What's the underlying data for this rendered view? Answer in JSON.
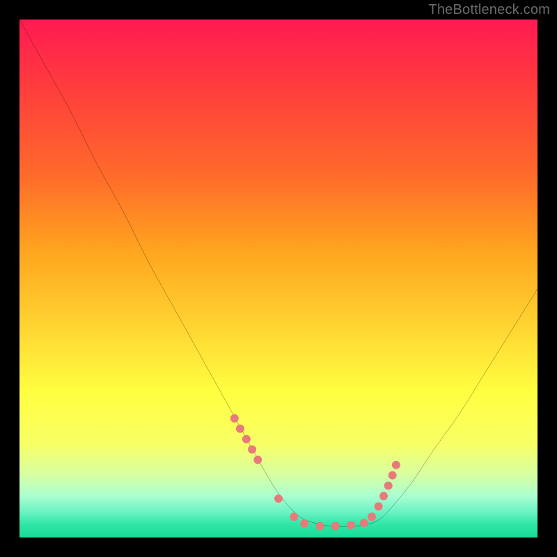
{
  "watermark": "TheBottleneck.com",
  "chart_data": {
    "type": "line",
    "title": "",
    "xlabel": "",
    "ylabel": "",
    "xlim": [
      0,
      100
    ],
    "ylim": [
      0,
      100
    ],
    "grid": false,
    "legend": false,
    "notes": "Axes are unlabeled; x and y are expressed as percent of plot width/height with origin at top-left (y increases downward). The black curve descends from upper-left into a flat trough near the bottom then rises toward the right. Salmon dots mark sample points near the trough. Background is a vertical red-to-green gradient.",
    "series": [
      {
        "name": "curve",
        "type": "line",
        "color": "#000000",
        "x": [
          0,
          5,
          10,
          15,
          20,
          25,
          30,
          35,
          40,
          45,
          49,
          52,
          55,
          60,
          65,
          69,
          72,
          76,
          80,
          85,
          90,
          95,
          100
        ],
        "y": [
          0,
          9,
          18,
          28,
          37,
          47,
          56,
          65,
          74,
          83,
          90,
          94,
          96.5,
          97.8,
          97.8,
          96.8,
          94,
          89,
          83,
          76,
          68,
          60,
          52
        ]
      },
      {
        "name": "trough-dots",
        "type": "scatter",
        "color": "#e77a7a",
        "x": [
          41.5,
          42.6,
          43.8,
          44.9,
          46.0,
          50.0,
          53.0,
          55.0,
          58.0,
          61.0,
          64.0,
          66.5,
          68.0,
          69.3,
          70.3,
          71.2,
          72.0,
          72.7
        ],
        "y": [
          77.0,
          79.0,
          81.0,
          83.0,
          85.0,
          92.5,
          96.0,
          97.3,
          97.8,
          97.8,
          97.6,
          97.2,
          96.0,
          94.0,
          92.0,
          90.0,
          88.0,
          86.0
        ]
      }
    ],
    "gradient_stops": [
      {
        "pos": 0,
        "color": "#ff1a52"
      },
      {
        "pos": 14,
        "color": "#ff3f3c"
      },
      {
        "pos": 30,
        "color": "#ff6a2a"
      },
      {
        "pos": 45,
        "color": "#ffa61f"
      },
      {
        "pos": 60,
        "color": "#ffd733"
      },
      {
        "pos": 72,
        "color": "#ffff40"
      },
      {
        "pos": 82,
        "color": "#f8ff66"
      },
      {
        "pos": 88,
        "color": "#d6ffa4"
      },
      {
        "pos": 92,
        "color": "#aaffd0"
      },
      {
        "pos": 95,
        "color": "#6cf3c4"
      },
      {
        "pos": 97.5,
        "color": "#2fe6a6"
      },
      {
        "pos": 100,
        "color": "#18dd96"
      }
    ]
  }
}
